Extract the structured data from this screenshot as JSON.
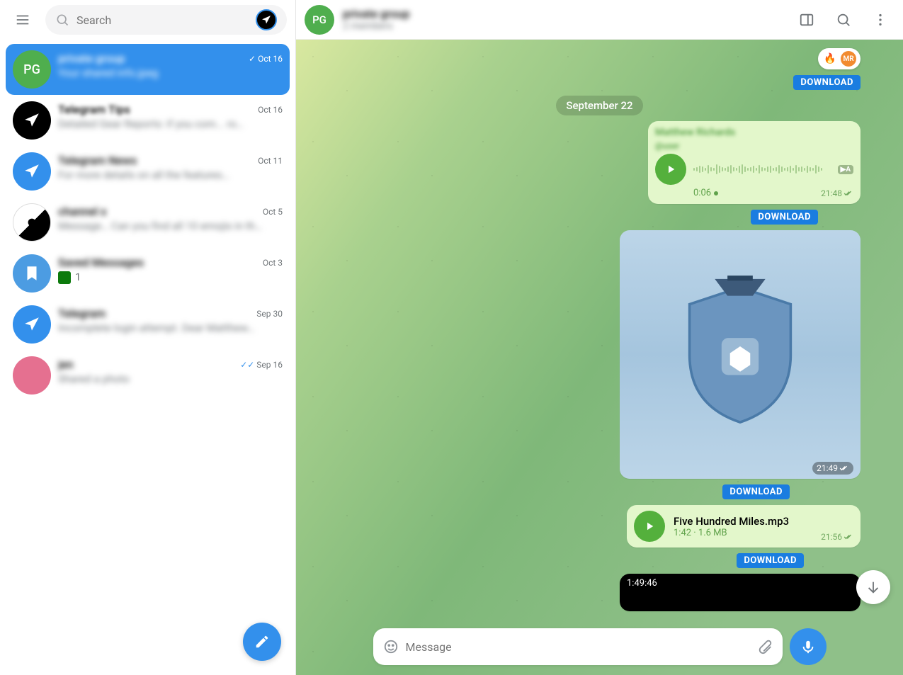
{
  "search_placeholder": "Search",
  "download_label": "DOWNLOAD",
  "date_separator": "September 22",
  "composer_placeholder": "Message",
  "header": {
    "title": "private group",
    "subtitle": "2 members",
    "avatar_text": "PG"
  },
  "reactions": {
    "mr": "MR",
    "fire": "🔥"
  },
  "voice": {
    "sender": "Matthew Richards",
    "handle": "@user",
    "duration": "0:06",
    "time": "21:48",
    "speed_badge": "▶A"
  },
  "image_msg": {
    "time": "21:49"
  },
  "audio_msg": {
    "title": "Five Hundred Miles.mp3",
    "meta": "1:42 · 1.6 MB",
    "time": "21:56"
  },
  "video_msg": {
    "duration": "1:49:46"
  },
  "chats": [
    {
      "title": "private group",
      "preview": "Your shared info.jpeg",
      "date": "Oct 16",
      "avatar_text": "PG",
      "avatar_class": "av-green",
      "check": "single"
    },
    {
      "title": "Telegram Tips",
      "preview": "Detailed Gear Reports: if you com... ro…",
      "date": "Oct 16",
      "avatar_class": "av-black"
    },
    {
      "title": "Telegram News",
      "preview": "For more details on all the features…",
      "date": "Oct 11",
      "avatar_class": "av-blue"
    },
    {
      "title": "channel x",
      "preview": "Message… Can you find all 10 emojis in th…",
      "date": "Oct 5",
      "avatar_class": "av-half"
    },
    {
      "title": "Saved Messages",
      "preview": "1",
      "date": "Oct 3",
      "avatar_class": "av-bookmark",
      "square": true
    },
    {
      "title": "Telegram",
      "preview": "Incomplete login attempt. Dear Matthew…",
      "date": "Sep 30",
      "avatar_class": "av-blue"
    },
    {
      "title": "jen",
      "preview": "Shared a photo",
      "date": "Sep 16",
      "avatar_class": "av-pink",
      "check": "double"
    }
  ]
}
